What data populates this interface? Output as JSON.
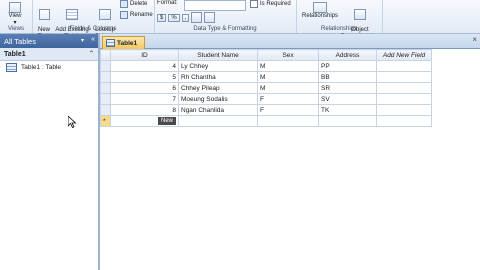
{
  "ribbon": {
    "views": {
      "view_label": "View",
      "group_label": "Views"
    },
    "fields_columns": {
      "new_field_label": "New\nField",
      "add_existing_label": "Add Existing\nFields",
      "lookup_column_label": "Lookup\nColumn",
      "delete_label": "Delete",
      "rename_label": "Rename",
      "group_label": "Fields & Columns"
    },
    "data_type": {
      "format_label": "Format:",
      "dollar_symbol": "$",
      "percent_symbol": "%",
      "comma_symbol": ",",
      "is_required_label": "Is Required",
      "group_label": "Data Type & Formatting"
    },
    "relationships": {
      "relationships_label": "Relationships",
      "object_dependencies_label": "Object\nDependencies",
      "group_label": "Relationships"
    }
  },
  "nav": {
    "header": "All Tables",
    "group": "Table1",
    "items": [
      {
        "label": "Table1 : Table"
      }
    ]
  },
  "document": {
    "tab_label": "Table1",
    "columns": [
      "ID",
      "Student Name",
      "Sex",
      "Address",
      "Add New Field"
    ],
    "rows": [
      {
        "id": "4",
        "name": "Ly Chhey",
        "sex": "M",
        "address": "PP"
      },
      {
        "id": "5",
        "name": "Rh Chantha",
        "sex": "M",
        "address": "BB"
      },
      {
        "id": "6",
        "name": "Chhey Pileap",
        "sex": "M",
        "address": "SR"
      },
      {
        "id": "7",
        "name": "Moeung Sodalis",
        "sex": "F",
        "address": "SV"
      },
      {
        "id": "8",
        "name": "Ngan Chanlida",
        "sex": "F",
        "address": "TK"
      }
    ],
    "new_row_marker": "*",
    "new_row_label": "New"
  }
}
